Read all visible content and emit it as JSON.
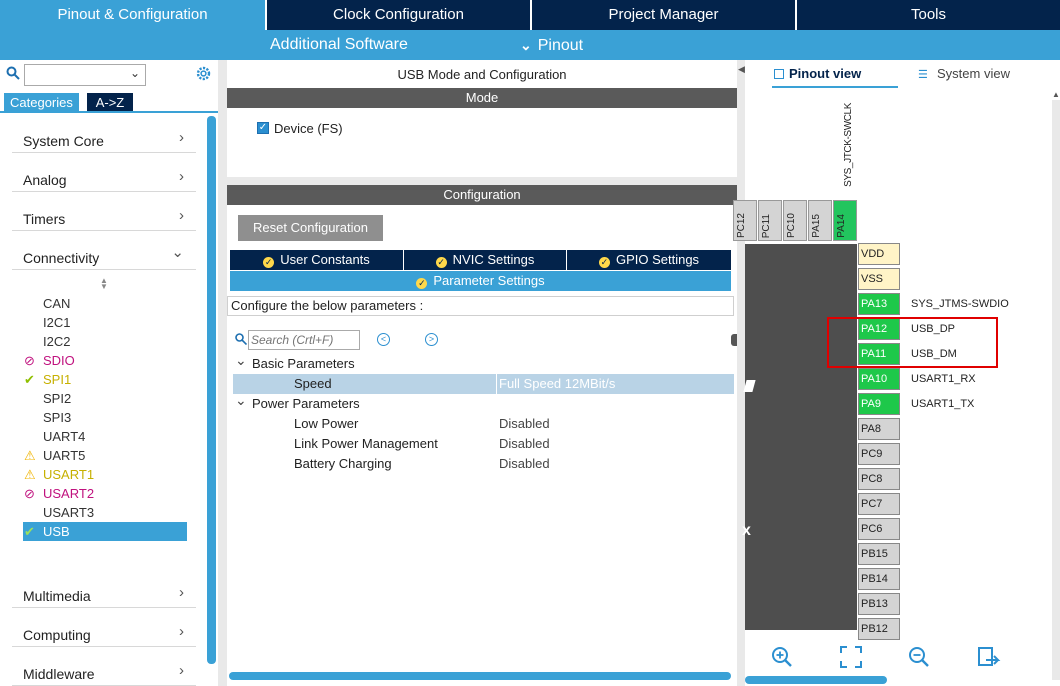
{
  "top_tabs": [
    "Pinout & Configuration",
    "Clock Configuration",
    "Project Manager",
    "Tools"
  ],
  "sub_tabs": {
    "additional_software": "Additional Software",
    "pinout": "Pinout",
    "pinout_arrow": "⌄"
  },
  "left": {
    "search_placeholder": "",
    "tab_categories": "Categories",
    "tab_az": "A->Z",
    "categories": [
      "System Core",
      "Analog",
      "Timers",
      "Connectivity"
    ],
    "connectivity_items": [
      {
        "label": "CAN",
        "icon": "",
        "color": "#333333"
      },
      {
        "label": "I2C1",
        "icon": "",
        "color": "#333333"
      },
      {
        "label": "I2C2",
        "icon": "",
        "color": "#333333"
      },
      {
        "label": "SDIO",
        "icon": "⊘",
        "color": "#c0117e"
      },
      {
        "label": "SPI1",
        "icon": "✔",
        "color": "#c6b000"
      },
      {
        "label": "SPI2",
        "icon": "",
        "color": "#333333"
      },
      {
        "label": "SPI3",
        "icon": "",
        "color": "#333333"
      },
      {
        "label": "UART4",
        "icon": "",
        "color": "#333333"
      },
      {
        "label": "UART5",
        "icon": "⚠",
        "color": "#333333"
      },
      {
        "label": "USART1",
        "icon": "⚠",
        "color": "#c6b000"
      },
      {
        "label": "USART2",
        "icon": "⊘",
        "color": "#c0117e"
      },
      {
        "label": "USART3",
        "icon": "",
        "color": "#333333"
      },
      {
        "label": "USB",
        "icon": "✔",
        "color": "#ffffff"
      }
    ],
    "bottom_categories": [
      "Multimedia",
      "Computing",
      "Middleware"
    ]
  },
  "middle": {
    "title": "USB Mode and Configuration",
    "mode_header": "Mode",
    "device_fs_label": "Device (FS)",
    "device_fs_checked": true,
    "config_header": "Configuration",
    "reset_button": "Reset Configuration",
    "tabs": [
      "User Constants",
      "NVIC Settings",
      "GPIO Settings"
    ],
    "active_tab": "Parameter Settings",
    "configure_text": "Configure the below parameters :",
    "search_placeholder": "Search (Crtl+F)",
    "groups": [
      {
        "name": "Basic Parameters",
        "params": [
          {
            "name": "Speed",
            "value": "Full Speed 12MBit/s",
            "selected": true
          }
        ]
      },
      {
        "name": "Power Parameters",
        "params": [
          {
            "name": "Low Power",
            "value": "Disabled"
          },
          {
            "name": "Link Power Management",
            "value": "Disabled"
          },
          {
            "name": "Battery Charging",
            "value": "Disabled"
          }
        ]
      }
    ]
  },
  "right": {
    "pinout_view": "Pinout view",
    "system_view": "System view",
    "top_signal": "SYS_JTCK-SWCLK",
    "top_pins": [
      {
        "label": "PC12",
        "color": "#d4d4d4"
      },
      {
        "label": "PC11",
        "color": "#d4d4d4"
      },
      {
        "label": "PC10",
        "color": "#d4d4d4"
      },
      {
        "label": "PA15",
        "color": "#d4d4d4"
      },
      {
        "label": "PA14",
        "color": "#22c55e"
      }
    ],
    "right_pins": [
      {
        "label": "VDD",
        "signal": "",
        "color": "#fff4c7"
      },
      {
        "label": "VSS",
        "signal": "",
        "color": "#fff4c7"
      },
      {
        "label": "PA13",
        "signal": "SYS_JTMS-SWDIO",
        "color": "#1ec84a"
      },
      {
        "label": "PA12",
        "signal": "USB_DP",
        "color": "#1ec84a"
      },
      {
        "label": "PA11",
        "signal": "USB_DM",
        "color": "#1ec84a"
      },
      {
        "label": "PA10",
        "signal": "USART1_RX",
        "color": "#1ec84a"
      },
      {
        "label": "PA9",
        "signal": "USART1_TX",
        "color": "#1ec84a"
      },
      {
        "label": "PA8",
        "signal": "",
        "color": "#d4d4d4"
      },
      {
        "label": "PC9",
        "signal": "",
        "color": "#d4d4d4"
      },
      {
        "label": "PC8",
        "signal": "",
        "color": "#d4d4d4"
      },
      {
        "label": "PC7",
        "signal": "",
        "color": "#d4d4d4"
      },
      {
        "label": "PC6",
        "signal": "",
        "color": "#d4d4d4"
      },
      {
        "label": "PB15",
        "signal": "",
        "color": "#d4d4d4"
      },
      {
        "label": "PB14",
        "signal": "",
        "color": "#d4d4d4"
      },
      {
        "label": "PB13",
        "signal": "",
        "color": "#d4d4d4"
      },
      {
        "label": "PB12",
        "signal": "",
        "color": "#d4d4d4"
      }
    ],
    "chip_glyph": "x",
    "tools": [
      "zoom-in-icon",
      "fit-icon",
      "zoom-out-icon",
      "export-icon"
    ]
  },
  "colors": {
    "navy": "#03234b",
    "blue": "#3aa1d6",
    "green": "#1ec84a",
    "highlight": "#e00000"
  }
}
